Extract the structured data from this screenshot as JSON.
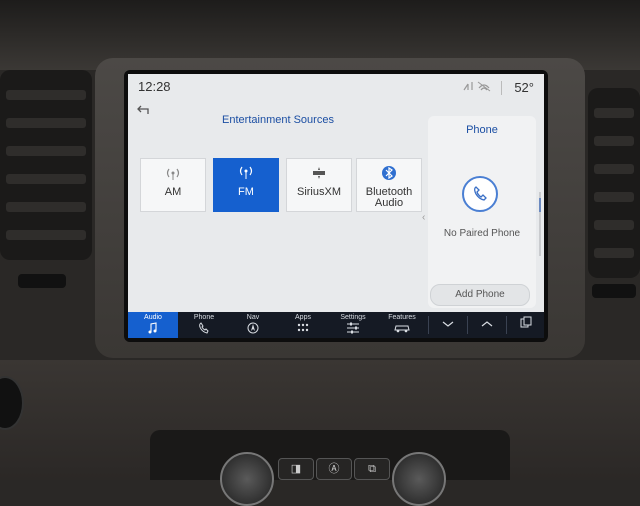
{
  "status": {
    "time": "12:28",
    "temperature": "52°",
    "icons": [
      "signal-off-icon",
      "wifi-off-icon"
    ]
  },
  "header": {
    "back_icon": "back-arrow-icon",
    "title": "Entertainment Sources"
  },
  "sources": [
    {
      "label": "AM",
      "icon": "am-radio-icon",
      "selected": false
    },
    {
      "label": "FM",
      "icon": "fm-radio-icon",
      "selected": true
    },
    {
      "label": "SiriusXM",
      "icon": "siriusxm-icon",
      "selected": false
    },
    {
      "label": "Bluetooth Audio",
      "icon": "bluetooth-icon",
      "selected": false
    }
  ],
  "phone_panel": {
    "title": "Phone",
    "status": "No Paired Phone",
    "add_button": "Add Phone"
  },
  "navbar": {
    "items": [
      {
        "label": "Audio",
        "icon": "music-note-icon",
        "active": true
      },
      {
        "label": "Phone",
        "icon": "phone-icon",
        "active": false
      },
      {
        "label": "Nav",
        "icon": "compass-icon",
        "active": false
      },
      {
        "label": "Apps",
        "icon": "apps-grid-icon",
        "active": false
      },
      {
        "label": "Settings",
        "icon": "sliders-icon",
        "active": false
      },
      {
        "label": "Features",
        "icon": "car-icon",
        "active": false
      }
    ],
    "extra_icons": [
      "chevron-down-icon",
      "chevron-up-icon",
      "screens-icon"
    ]
  },
  "colors": {
    "accent": "#1560cf",
    "panel_title": "#1c4fa3",
    "navbar_bg": "#151a24"
  }
}
